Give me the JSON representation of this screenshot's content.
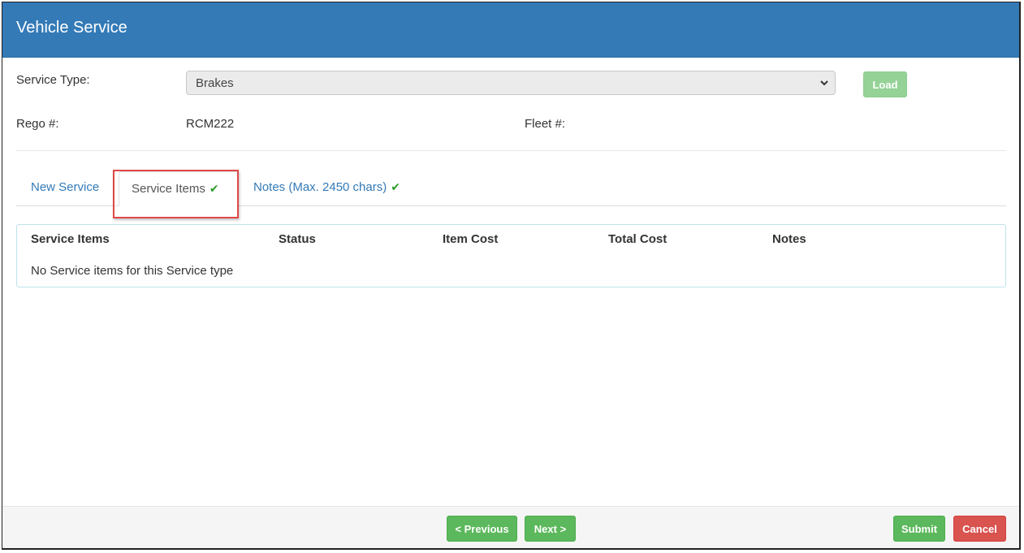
{
  "header": {
    "title": "Vehicle Service"
  },
  "form": {
    "service_type_label": "Service Type:",
    "service_type_value": "Brakes",
    "load_label": "Load",
    "rego_label": "Rego #:",
    "rego_value": "RCM222",
    "fleet_label": "Fleet #:",
    "fleet_value": ""
  },
  "tabs": [
    {
      "label": "New Service",
      "checked": false,
      "active": false
    },
    {
      "label": "Service Items",
      "checked": true,
      "active": true
    },
    {
      "label": "Notes (Max. 2450 chars)",
      "checked": true,
      "active": false
    }
  ],
  "table": {
    "columns": [
      "Service Items",
      "Status",
      "Item Cost",
      "Total Cost",
      "Notes"
    ],
    "empty_message": "No Service items for this Service type"
  },
  "footer": {
    "previous_label": "< Previous",
    "next_label": "Next >",
    "submit_label": "Submit",
    "cancel_label": "Cancel"
  },
  "colors": {
    "header": "#337ab7",
    "success": "#5cb85c",
    "danger": "#d9534f",
    "link": "#337ab7",
    "check": "#2a9d2a",
    "highlight": "#e04848"
  },
  "icons": {
    "check": "checkmark-icon",
    "dropdown": "chevron-down-icon"
  }
}
